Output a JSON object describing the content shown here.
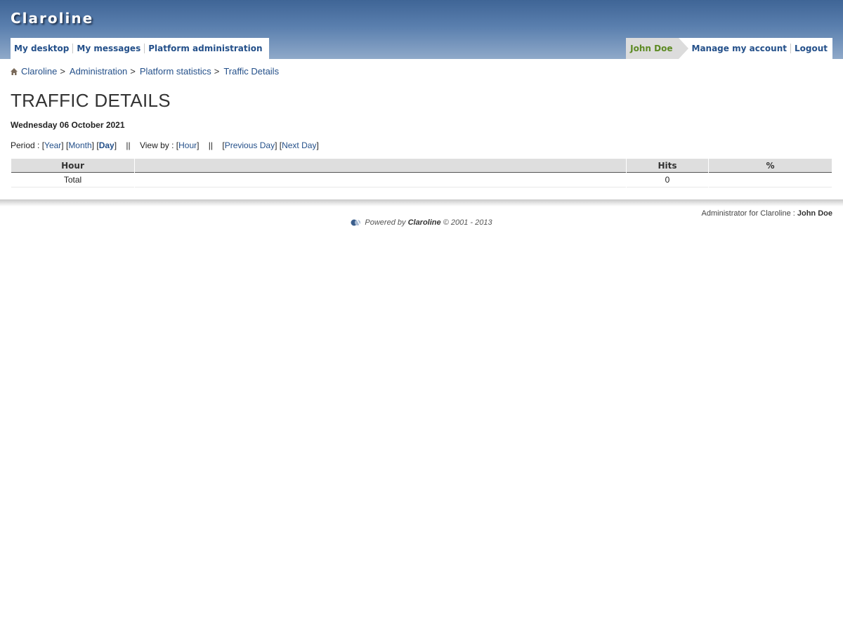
{
  "header": {
    "campus_name": "Claroline",
    "nav": [
      "My desktop",
      "My messages",
      "Platform administration"
    ],
    "user": {
      "name": "John Doe",
      "manage_account": "Manage my account",
      "logout": "Logout"
    }
  },
  "breadcrumb": [
    "Claroline",
    "Administration",
    "Platform statistics",
    "Traffic Details"
  ],
  "page": {
    "title": "TRAFFIC DETAILS",
    "date": "Wednesday 06 October 2021"
  },
  "filters": {
    "period_label": "Period : ",
    "year": "Year",
    "month": "Month",
    "day": "Day",
    "separator": "||",
    "viewby_label": "View by : ",
    "hour": "Hour",
    "previous_day": "Previous Day",
    "next_day": "Next Day"
  },
  "table": {
    "headers": [
      "Hour",
      "",
      "Hits",
      "%"
    ],
    "rows": [
      [
        "Total",
        "",
        "0",
        ""
      ]
    ]
  },
  "footer": {
    "admin_label": "Administrator for Claroline : ",
    "admin_name": "John Doe",
    "powered_by": "Powered by ",
    "product": "Claroline",
    "copyright": " © 2001 - 2013"
  }
}
